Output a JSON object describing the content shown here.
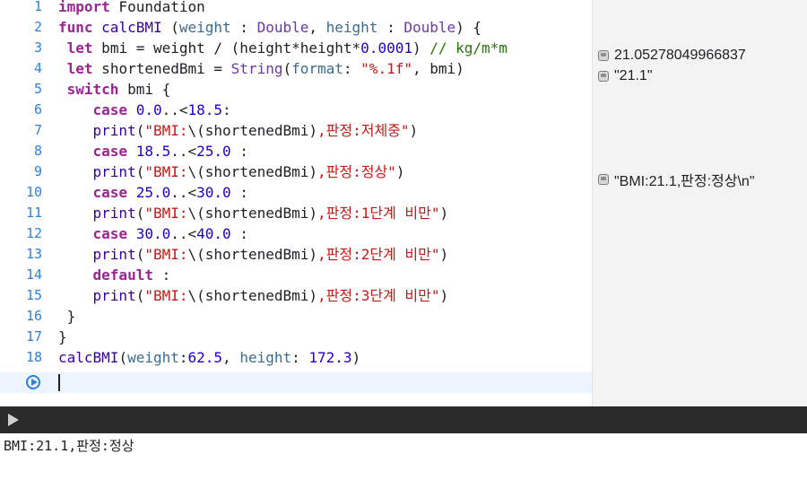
{
  "editor": {
    "lines": [
      {
        "n": "1",
        "tokens": [
          [
            "kw",
            "import"
          ],
          [
            "ident",
            " Foundation"
          ]
        ]
      },
      {
        "n": "2",
        "tokens": [
          [
            "kw",
            "func"
          ],
          [
            "ident",
            " "
          ],
          [
            "fn",
            "calcBMI"
          ],
          [
            "ident",
            " ("
          ],
          [
            "par",
            "weight"
          ],
          [
            "ident",
            " : "
          ],
          [
            "ty",
            "Double"
          ],
          [
            "ident",
            ", "
          ],
          [
            "par",
            "height"
          ],
          [
            "ident",
            " : "
          ],
          [
            "ty",
            "Double"
          ],
          [
            "ident",
            ") {"
          ]
        ]
      },
      {
        "n": "3",
        "tokens": [
          [
            "ident",
            " "
          ],
          [
            "kw",
            "let"
          ],
          [
            "ident",
            " bmi = weight / (height*height*"
          ],
          [
            "num",
            "0.0001"
          ],
          [
            "ident",
            ") "
          ],
          [
            "cm",
            "// kg/m*m"
          ]
        ]
      },
      {
        "n": "4",
        "tokens": [
          [
            "ident",
            " "
          ],
          [
            "kw",
            "let"
          ],
          [
            "ident",
            " shortenedBmi = "
          ],
          [
            "ty",
            "String"
          ],
          [
            "ident",
            "("
          ],
          [
            "par",
            "format"
          ],
          [
            "ident",
            ": "
          ],
          [
            "str",
            "\"%.1f\""
          ],
          [
            "ident",
            ", bmi)"
          ]
        ]
      },
      {
        "n": "5",
        "tokens": [
          [
            "ident",
            " "
          ],
          [
            "kw",
            "switch"
          ],
          [
            "ident",
            " bmi {"
          ]
        ]
      },
      {
        "n": "6",
        "tokens": [
          [
            "ident",
            "    "
          ],
          [
            "kw",
            "case"
          ],
          [
            "ident",
            " "
          ],
          [
            "num",
            "0.0"
          ],
          [
            "ident",
            "..<"
          ],
          [
            "num",
            "18.5"
          ],
          [
            "ident",
            ":"
          ]
        ]
      },
      {
        "n": "7",
        "tokens": [
          [
            "ident",
            "    "
          ],
          [
            "fn",
            "print"
          ],
          [
            "ident",
            "("
          ],
          [
            "str",
            "\"BMI:"
          ],
          [
            "ident",
            "\\(shortenedBmi)"
          ],
          [
            "str",
            ",판정:저체중\""
          ],
          [
            "ident",
            ")"
          ]
        ]
      },
      {
        "n": "8",
        "tokens": [
          [
            "ident",
            "    "
          ],
          [
            "kw",
            "case"
          ],
          [
            "ident",
            " "
          ],
          [
            "num",
            "18.5"
          ],
          [
            "ident",
            "..<"
          ],
          [
            "num",
            "25.0"
          ],
          [
            "ident",
            " :"
          ]
        ]
      },
      {
        "n": "9",
        "tokens": [
          [
            "ident",
            "    "
          ],
          [
            "fn",
            "print"
          ],
          [
            "ident",
            "("
          ],
          [
            "str",
            "\"BMI:"
          ],
          [
            "ident",
            "\\(shortenedBmi)"
          ],
          [
            "str",
            ",판정:정상\""
          ],
          [
            "ident",
            ")"
          ]
        ]
      },
      {
        "n": "10",
        "tokens": [
          [
            "ident",
            "    "
          ],
          [
            "kw",
            "case"
          ],
          [
            "ident",
            " "
          ],
          [
            "num",
            "25.0"
          ],
          [
            "ident",
            "..<"
          ],
          [
            "num",
            "30.0"
          ],
          [
            "ident",
            " :"
          ]
        ]
      },
      {
        "n": "11",
        "tokens": [
          [
            "ident",
            "    "
          ],
          [
            "fn",
            "print"
          ],
          [
            "ident",
            "("
          ],
          [
            "str",
            "\"BMI:"
          ],
          [
            "ident",
            "\\(shortenedBmi)"
          ],
          [
            "str",
            ",판정:1단계 비만\""
          ],
          [
            "ident",
            ")"
          ]
        ]
      },
      {
        "n": "12",
        "tokens": [
          [
            "ident",
            "    "
          ],
          [
            "kw",
            "case"
          ],
          [
            "ident",
            " "
          ],
          [
            "num",
            "30.0"
          ],
          [
            "ident",
            "..<"
          ],
          [
            "num",
            "40.0"
          ],
          [
            "ident",
            " :"
          ]
        ]
      },
      {
        "n": "13",
        "tokens": [
          [
            "ident",
            "    "
          ],
          [
            "fn",
            "print"
          ],
          [
            "ident",
            "("
          ],
          [
            "str",
            "\"BMI:"
          ],
          [
            "ident",
            "\\(shortenedBmi)"
          ],
          [
            "str",
            ",판정:2단계 비만\""
          ],
          [
            "ident",
            ")"
          ]
        ]
      },
      {
        "n": "14",
        "tokens": [
          [
            "ident",
            "    "
          ],
          [
            "kw",
            "default"
          ],
          [
            "ident",
            " :"
          ]
        ]
      },
      {
        "n": "15",
        "tokens": [
          [
            "ident",
            "    "
          ],
          [
            "fn",
            "print"
          ],
          [
            "ident",
            "("
          ],
          [
            "str",
            "\"BMI:"
          ],
          [
            "ident",
            "\\(shortenedBmi)"
          ],
          [
            "str",
            ",판정:3단계 비만\""
          ],
          [
            "ident",
            ")"
          ]
        ]
      },
      {
        "n": "16",
        "tokens": [
          [
            "ident",
            " }"
          ]
        ]
      },
      {
        "n": "17",
        "tokens": [
          [
            "ident",
            "}"
          ]
        ]
      },
      {
        "n": "18",
        "tokens": [
          [
            "fn",
            "calcBMI"
          ],
          [
            "ident",
            "("
          ],
          [
            "par",
            "weight"
          ],
          [
            "ident",
            ":"
          ],
          [
            "num",
            "62.5"
          ],
          [
            "ident",
            ", "
          ],
          [
            "par",
            "height"
          ],
          [
            "ident",
            ": "
          ],
          [
            "num",
            "172.3"
          ],
          [
            "ident",
            ")"
          ]
        ]
      }
    ]
  },
  "results": [
    {
      "line": 3,
      "text": "21.05278049966837"
    },
    {
      "line": 4,
      "text": "\"21.1\""
    },
    {
      "line": 9,
      "text": "\"BMI:21.1,판정:정상\\n\""
    }
  ],
  "console": {
    "output": "BMI:21.1,판정:정상"
  },
  "colors": {
    "keyword": "#9b2393",
    "string": "#c41a16",
    "number": "#1c00cf",
    "comment": "#267507",
    "line_number": "#2f7fe0"
  }
}
